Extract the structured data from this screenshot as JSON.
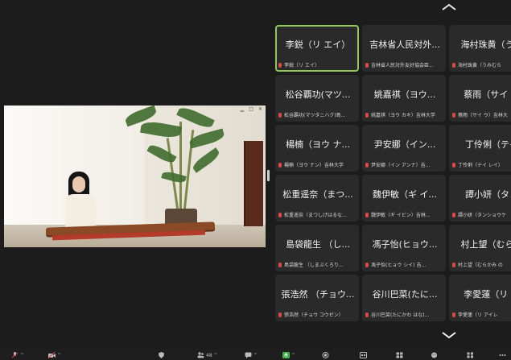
{
  "gallery": {
    "tiles": [
      {
        "name": "李鋭（リ エイ）",
        "caption": "李鋭（リ エイ）",
        "active": true
      },
      {
        "name": "吉林省人民対外...",
        "caption": "吉林省人民対外友好協会臣..."
      },
      {
        "name": "海村珠黄（うみ",
        "caption": "海村珠黄（うみむら"
      },
      {
        "name": "松谷覇功(マツ...",
        "caption": "松谷覇功(マツタニハク)島..."
      },
      {
        "name": "姚嘉祺（ヨウ...",
        "caption": "姚嘉祺（ヨウ カキ）吉林大学"
      },
      {
        "name": "蔡雨（サイ ウ",
        "caption": "蔡雨（サイ ウ）吉林大"
      },
      {
        "name": "楊楠（ヨウ ナ...",
        "caption": "楊楠（ヨウ ナン）吉林大学"
      },
      {
        "name": "尹安娜（イン...",
        "caption": "尹安娜（イン アンナ）吉..."
      },
      {
        "name": "丁伶俐（テイ",
        "caption": "丁伶俐（テイ レイ）"
      },
      {
        "name": "松重遥奈（まつ...",
        "caption": "松重遥奈（まつしげはるな..."
      },
      {
        "name": "魏伊敏（ギ イ...",
        "caption": "魏伊敏（ギ イビン）吉林..."
      },
      {
        "name": "譚小妍（タン",
        "caption": "譚小妍（タンショウケ"
      },
      {
        "name": "島袋龍生 （し...",
        "caption": "島袋龍生 （しまぶくろり..."
      },
      {
        "name": "馮子怡(ヒョウ...",
        "caption": "馮子怡(ヒョウ シイ) 吉..."
      },
      {
        "name": "村上望（むらか",
        "caption": "村上望（むらかみ の"
      },
      {
        "name": "張浩然 （チョウ...",
        "caption": "張浩然（チョウ コウゼン）"
      },
      {
        "name": "谷川巴菜(たに...",
        "caption": "谷川巴菜(たにかわ はな)..."
      },
      {
        "name": "李愛蓮（リ ア",
        "caption": "李愛蓮（リ アイレ"
      }
    ]
  },
  "icons": {
    "scroll_up": "chevron-up-icon",
    "scroll_down": "chevron-down-icon"
  },
  "toolbar": {
    "participants_count": "48"
  },
  "colors": {
    "active_border": "#8ec95a",
    "muted_mic": "#e04848",
    "share_green": "#3bb54a"
  }
}
